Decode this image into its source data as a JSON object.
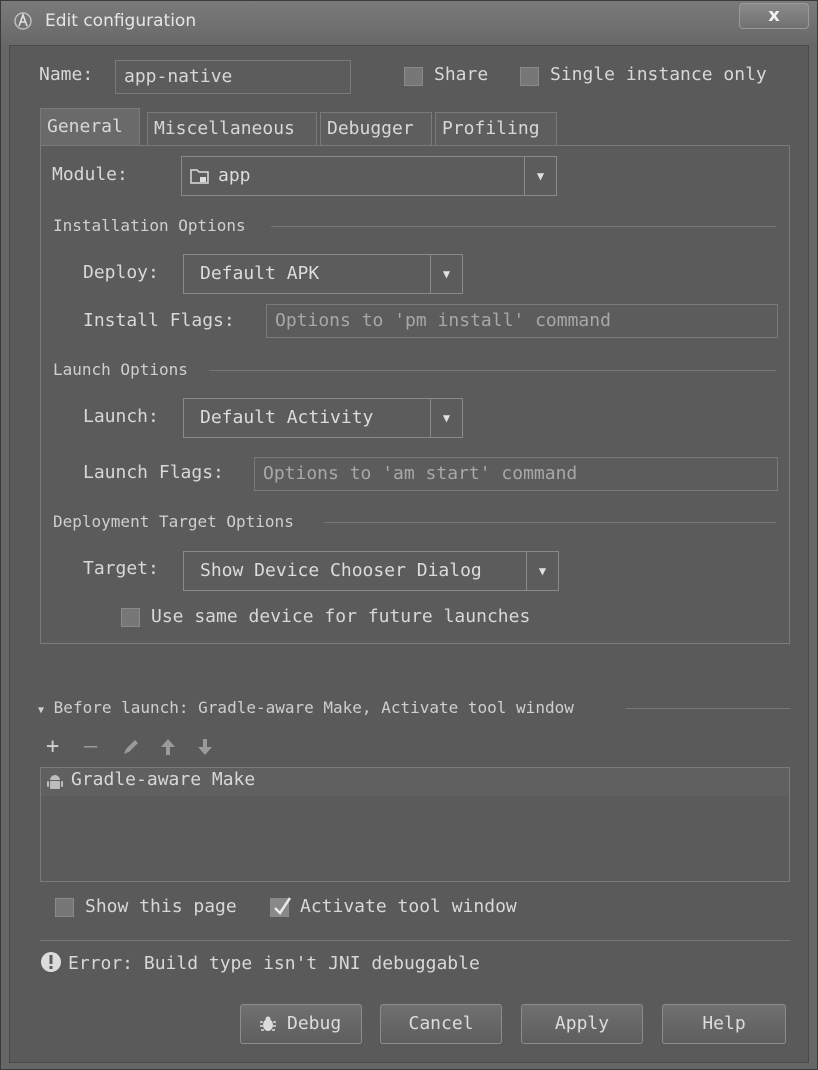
{
  "window": {
    "title": "Edit configuration",
    "close_label": "x"
  },
  "name_row": {
    "label": "Name:",
    "value": "app-native",
    "share_label": "Share",
    "share_checked": false,
    "single_instance_label": "Single instance only",
    "single_instance_checked": false
  },
  "tabs": [
    {
      "label": "General",
      "active": true
    },
    {
      "label": "Miscellaneous",
      "active": false
    },
    {
      "label": "Debugger",
      "active": false
    },
    {
      "label": "Profiling",
      "active": false
    }
  ],
  "general": {
    "module_label": "Module:",
    "module_value": "app",
    "installation_title": "Installation Options",
    "deploy_label": "Deploy:",
    "deploy_value": "Default APK",
    "install_flags_label": "Install Flags:",
    "install_flags_placeholder": "Options to 'pm install' command",
    "launch_title": "Launch Options",
    "launch_label": "Launch:",
    "launch_value": "Default Activity",
    "launch_flags_label": "Launch Flags:",
    "launch_flags_placeholder": "Options to 'am start' command",
    "deployment_title": "Deployment Target Options",
    "target_label": "Target:",
    "target_value": "Show Device Chooser Dialog",
    "same_device_label": "Use same device for future launches",
    "same_device_checked": false
  },
  "before_launch": {
    "title": "Before launch: Gradle-aware Make, Activate tool window",
    "items": [
      "Gradle-aware Make"
    ],
    "toolbar_icons": [
      "plus-icon",
      "minus-icon",
      "pencil-icon",
      "arrow-up-icon",
      "arrow-down-icon"
    ]
  },
  "options": {
    "show_page_label": "Show this page",
    "show_page_checked": false,
    "activate_tool_label": "Activate tool window",
    "activate_tool_checked": true
  },
  "error": {
    "text": "Error: Build type isn't JNI debuggable"
  },
  "buttons": {
    "debug": "Debug",
    "cancel": "Cancel",
    "apply": "Apply",
    "help": "Help"
  }
}
